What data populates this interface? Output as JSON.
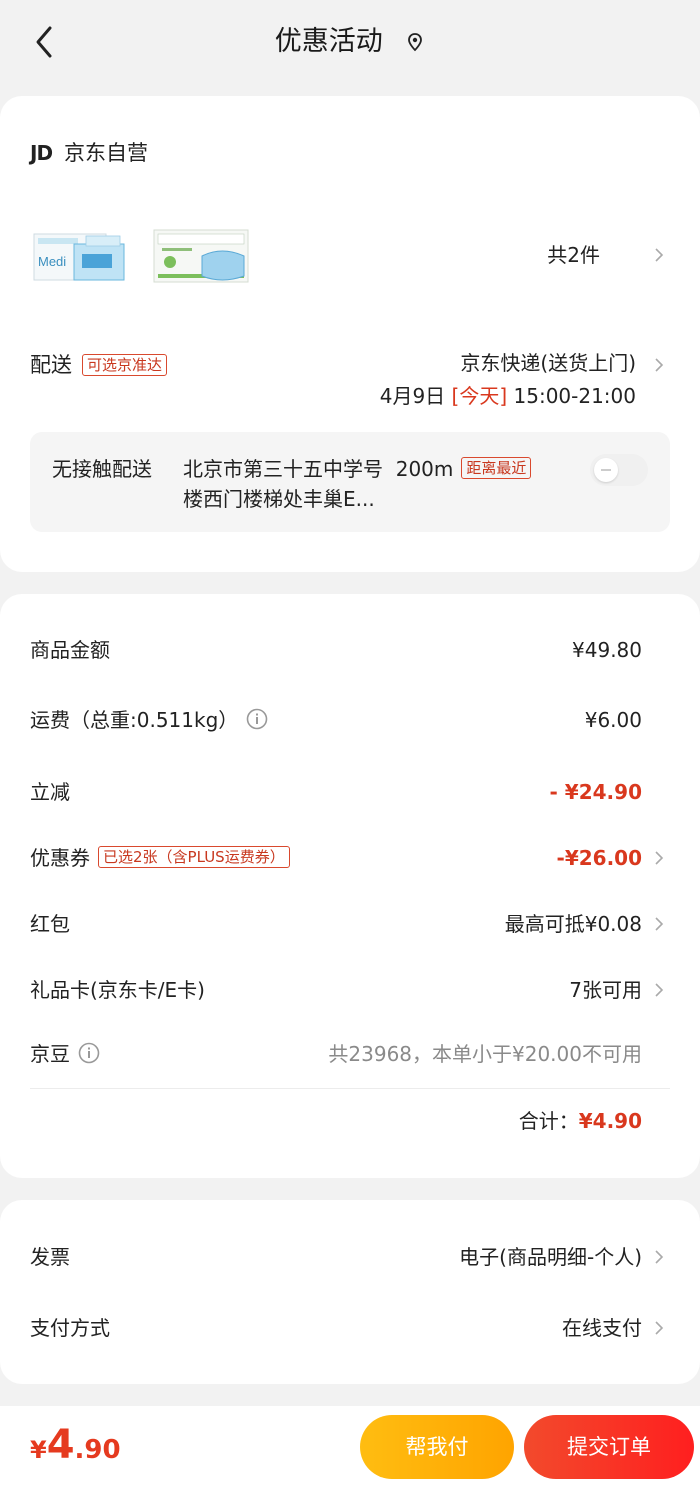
{
  "header": {
    "title": "优惠活动"
  },
  "shop": {
    "logo": "JD",
    "name": "京东自营",
    "item_count": "共2件"
  },
  "delivery": {
    "label": "配送",
    "tag": "可选京准达",
    "method": "京东快递(送货上门)",
    "date": "4月9日",
    "today": "[今天]",
    "time": "15:00-21:00",
    "contactless_label": "无接触配送",
    "locker_line1": "北京市第三十五中学号",
    "locker_distance": "200m",
    "locker_tag": "距离最近",
    "locker_line2": "楼西门楼梯处丰巢E..."
  },
  "summary": {
    "rows": [
      {
        "label": "商品金额",
        "value": "¥49.80"
      },
      {
        "label": "运费（总重:0.511kg）",
        "value": "¥6.00"
      },
      {
        "label": "立减",
        "value": "- ¥24.90"
      },
      {
        "label": "优惠券",
        "tag": "已选2张（含PLUS运费券）",
        "value": "-¥26.00"
      },
      {
        "label": "红包",
        "value": "最高可抵¥0.08"
      },
      {
        "label": "礼品卡(京东卡/E卡)",
        "value": "7张可用"
      },
      {
        "label": "京豆",
        "value": "共23968，本单小于¥20.00不可用"
      }
    ],
    "total_label": "合计：",
    "total_value": "¥4.90"
  },
  "invoice": {
    "label": "发票",
    "value": "电子(商品明细-个人)"
  },
  "payment": {
    "label": "支付方式",
    "value": "在线支付"
  },
  "footer": {
    "price_yen": "¥",
    "price_int": "4",
    "price_dec": ".90",
    "help_pay_label": "帮我付",
    "submit_label": "提交订单"
  },
  "colors": {
    "accent_red": "#e53a1f",
    "help_pay_orange": "#ffb10a"
  }
}
